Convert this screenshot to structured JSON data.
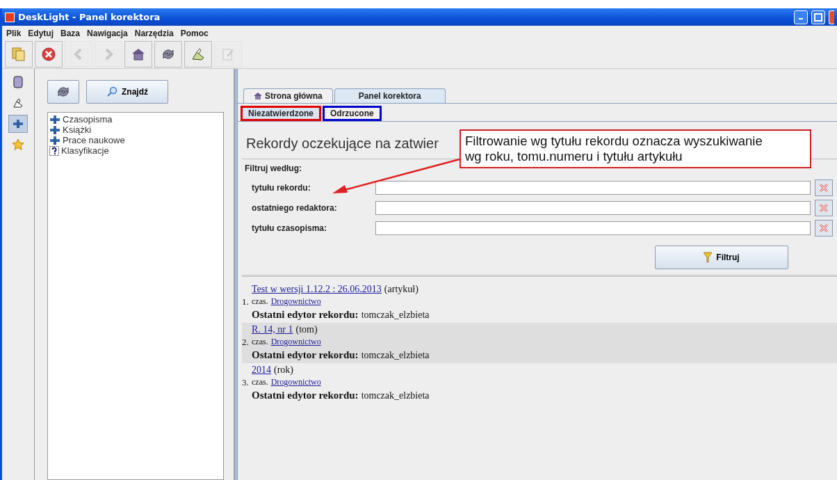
{
  "window": {
    "title": "DeskLight - Panel korektora"
  },
  "menu": [
    "Plik",
    "Edytuj",
    "Baza",
    "Nawigacja",
    "Narzędzia",
    "Pomoc"
  ],
  "toolbar": [
    {
      "kind": "copy",
      "disabled": false
    },
    {
      "kind": "stop",
      "disabled": false
    },
    {
      "kind": "back",
      "disabled": true
    },
    {
      "kind": "forward",
      "disabled": true
    },
    {
      "kind": "home",
      "disabled": false
    },
    {
      "kind": "refresh",
      "disabled": false
    },
    {
      "kind": "editor",
      "disabled": false
    },
    {
      "kind": "edit",
      "disabled": true
    }
  ],
  "side_strip": [
    {
      "kind": "book",
      "selected": false
    },
    {
      "kind": "editor",
      "selected": false
    },
    {
      "kind": "tree",
      "selected": true
    },
    {
      "kind": "star",
      "selected": false
    }
  ],
  "tree_panel": {
    "find_button": "Znajdź",
    "items": [
      {
        "kind": "folder",
        "label": "Czasopisma"
      },
      {
        "kind": "folder",
        "label": "Książki"
      },
      {
        "kind": "folder",
        "label": "Prace naukowe"
      },
      {
        "kind": "question",
        "label": "Klasyfikacje"
      }
    ]
  },
  "tabs": [
    {
      "label": "Strona główna",
      "kind": "home",
      "selected": false
    },
    {
      "label": "Panel korektora",
      "kind": "plain",
      "selected": true
    }
  ],
  "subtabs": [
    {
      "label": "Niezatwierdzone",
      "selected": true,
      "color": "#e00000"
    },
    {
      "label": "Odrzucone",
      "selected": false,
      "color": "#0000cc"
    }
  ],
  "heading": "Rekordy oczekujące na zatwier",
  "callout": "Filtrowanie wg tytułu rekordu oznacza wyszukiwanie\nwg roku, tomu.numeru i tytułu artykułu",
  "filter": {
    "title": "Filtruj według:",
    "fields": [
      {
        "label": "tytułu rekordu:"
      },
      {
        "label": "ostatniego redaktora:"
      },
      {
        "label": "tytułu czasopisma:"
      }
    ],
    "button": "Filtruj"
  },
  "records": [
    {
      "number": "1.",
      "title": "Test w wersji 1.12.2 : 26.06.2013",
      "type": "(artykuł)",
      "prefix": "czas.",
      "journal": "Drogownictwo",
      "editor_label": "Ostatni edytor rekordu:",
      "editor": "tomczak_elzbieta",
      "highlighted": false
    },
    {
      "number": "2.",
      "title": "R. 14, nr 1",
      "type": "(tom)",
      "prefix": "czas.",
      "journal": "Drogownictwo",
      "editor_label": "Ostatni edytor rekordu:",
      "editor": "tomczak_elzbieta",
      "highlighted": true
    },
    {
      "number": "3.",
      "title": "2014",
      "type": "(rok)",
      "prefix": "czas.",
      "journal": "Drogownictwo",
      "editor_label": "Ostatni edytor rekordu:",
      "editor": "tomczak_elzbieta",
      "highlighted": false
    }
  ]
}
